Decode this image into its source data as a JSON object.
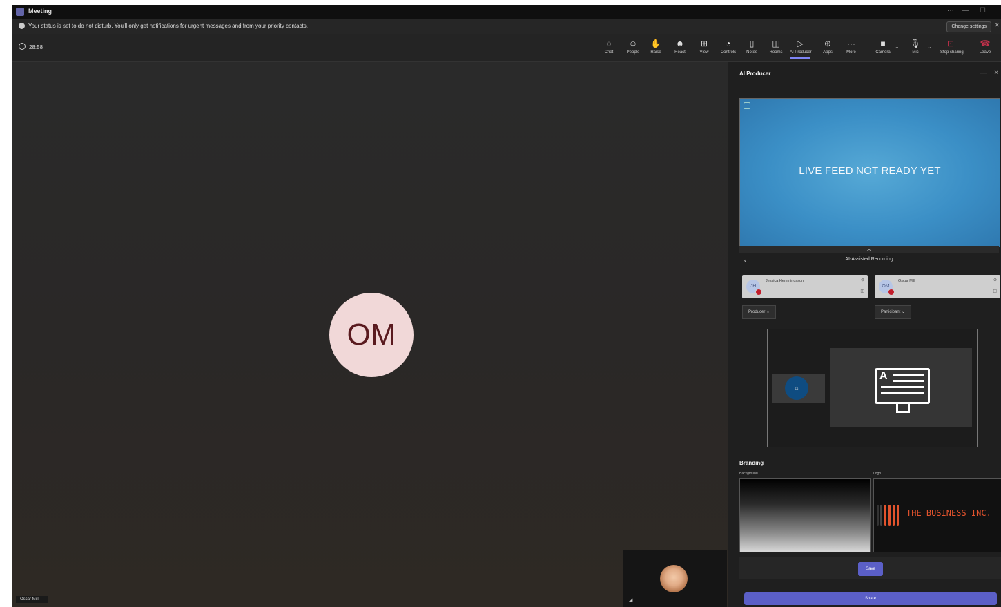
{
  "window": {
    "title": "Meeting"
  },
  "banner": {
    "message": "Your status is set to do not disturb. You'll only get notifications for urgent messages and from your priority contacts.",
    "action": "Change settings"
  },
  "toolbar": {
    "timer": "28:58",
    "items": [
      {
        "label": "Chat",
        "icon": "chat-icon"
      },
      {
        "label": "People",
        "icon": "people-icon"
      },
      {
        "label": "Raise",
        "icon": "hand-icon"
      },
      {
        "label": "React",
        "icon": "smile-icon"
      },
      {
        "label": "View",
        "icon": "view-icon"
      },
      {
        "label": "Controls",
        "icon": "controls-icon"
      },
      {
        "label": "Notes",
        "icon": "notes-icon"
      },
      {
        "label": "Rooms",
        "icon": "rooms-icon"
      },
      {
        "label": "AI Producer",
        "icon": "play-icon"
      },
      {
        "label": "Apps",
        "icon": "apps-icon"
      },
      {
        "label": "More",
        "icon": "more-icon"
      },
      {
        "label": "Camera",
        "icon": "camera-icon"
      },
      {
        "label": "Mic",
        "icon": "mic-icon"
      },
      {
        "label": "Stop sharing",
        "icon": "share-icon"
      },
      {
        "label": "Leave",
        "icon": "phone-icon"
      }
    ]
  },
  "stage": {
    "avatar_initials": "OM",
    "name_tag": "Oscar Mill"
  },
  "panel": {
    "title": "AI Producer",
    "live_feed_text": "LIVE FEED NOT READY YET",
    "recording_title": "AI-Assisted Recording",
    "participants": [
      {
        "name": "Jessica Hemmingsson",
        "initials": "JH",
        "role": "Producer"
      },
      {
        "name": "Oscar Mill",
        "initials": "OM",
        "role": "Participant"
      }
    ],
    "branding": {
      "title": "Branding",
      "background_label": "Background",
      "logo_label": "Logo",
      "logo_text": "THE BUSINESS INC."
    },
    "save_label": "Save",
    "share_label": "Share"
  },
  "colors": {
    "accent": "#5b5fc7",
    "live_blue": "#3b8fc6",
    "leave_red": "#c4314b",
    "avatar_bg": "#f1d8d8"
  }
}
